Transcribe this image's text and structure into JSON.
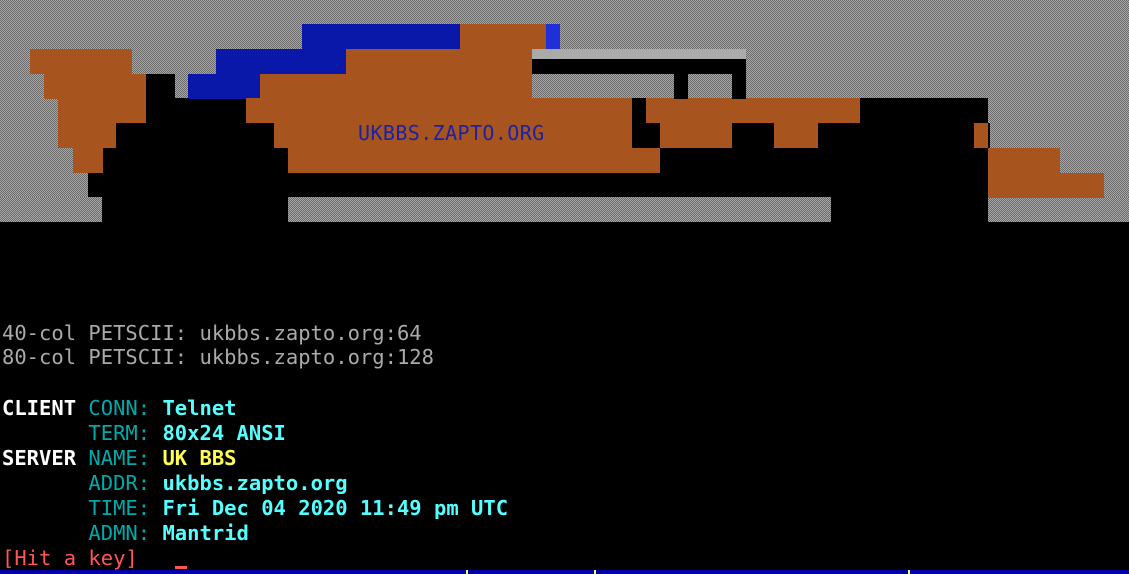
{
  "banner": {
    "label": "UKBBS.ZAPTO.ORG"
  },
  "connect_info": [
    "40-col PETSCII: ukbbs.zapto.org:64",
    "80-col PETSCII: ukbbs.zapto.org:128"
  ],
  "client": {
    "section": "CLIENT",
    "conn_key": "CONN:",
    "conn_val": "Telnet",
    "term_key": "TERM:",
    "term_val": "80x24 ANSI"
  },
  "server": {
    "section": "SERVER",
    "name_key": "NAME:",
    "name_val": "UK BBS",
    "addr_key": "ADDR:",
    "addr_val": "ukbbs.zapto.org",
    "time_key": "TIME:",
    "time_val": "Fri Dec 04 2020 11:49 pm UTC",
    "admn_key": "ADMN:",
    "admn_val": "Mantrid"
  },
  "prompt": "[Hit a key]",
  "colors": {
    "background": "#000000",
    "gray_text": "#aaaaaa",
    "white_text": "#ffffff",
    "cyan_key": "#00aaaa",
    "bright_cyan_value": "#55ffff",
    "yellow_value": "#ffff55",
    "red_prompt": "#ff5555",
    "art_orange": "#a8541e",
    "art_blue": "#0a18aa"
  }
}
